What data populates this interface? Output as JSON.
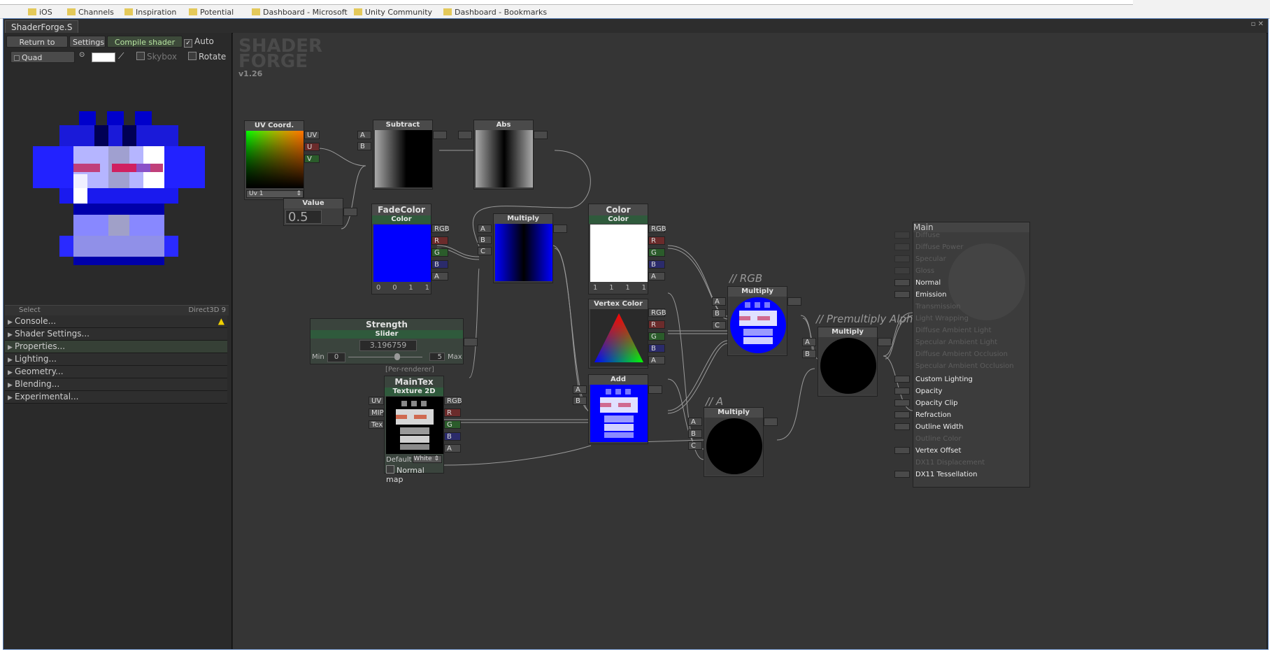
{
  "browser": {
    "bookmarks": [
      "iOS",
      "Channels",
      "Inspiration",
      "Potential",
      "Dashboard - Microsoft",
      "Unity Community",
      "Dashboard - Bookmarks"
    ]
  },
  "window": {
    "tab_title": "ShaderForge.S",
    "controls": "▫ ✕"
  },
  "toolbar": {
    "return_label": "Return to menu",
    "settings_label": "Settings",
    "compile_label": "Compile shader",
    "auto_label": "Auto",
    "auto_checked": true,
    "mesh_label": "Quad",
    "skybox_label": "Skybox",
    "rotate_label": "Rotate"
  },
  "panel": {
    "select_label": "Select",
    "renderer_label": "Direct3D 9",
    "menu_items": [
      "Console...",
      "Shader Settings...",
      "Properties...",
      "Lighting...",
      "Geometry...",
      "Blending...",
      "Experimental..."
    ]
  },
  "canvas": {
    "logo_line1": "SHADER",
    "logo_line2": "FORGE",
    "version": "v1.26",
    "comment_rgb": "// RGB",
    "comment_premultiply": "// Premultiply Alpha",
    "comment_a": "// A"
  },
  "nodes": {
    "uv": {
      "title": "UV Coord.",
      "ports": [
        "UV",
        "U",
        "V"
      ],
      "channel": "Uv 1"
    },
    "value": {
      "title": "Value",
      "value": "0.5"
    },
    "subtract": {
      "title": "Subtract",
      "in": [
        "A",
        "B"
      ]
    },
    "abs": {
      "title": "Abs"
    },
    "fadecolor": {
      "title": "FadeColor",
      "subtitle": "Color",
      "ports": [
        "RGB",
        "R",
        "G",
        "B",
        "A"
      ],
      "values": [
        "0",
        "0",
        "1",
        "1"
      ],
      "swatch": "#0000ff"
    },
    "multiply1": {
      "title": "Multiply",
      "in": [
        "A",
        "B",
        "C"
      ]
    },
    "color": {
      "title": "Color",
      "subtitle": "Color",
      "ports": [
        "RGB",
        "R",
        "G",
        "B",
        "A"
      ],
      "values": [
        "1",
        "1",
        "1",
        "1"
      ],
      "swatch": "#ffffff"
    },
    "vertexcolor": {
      "title": "Vertex Color",
      "ports": [
        "RGB",
        "R",
        "G",
        "B",
        "A"
      ]
    },
    "strength": {
      "title": "Strength",
      "subtitle": "Slider",
      "value": "3.196759",
      "min_label": "Min",
      "min": "0",
      "max": "5",
      "max_label": "Max",
      "footer": "[Per-renderer]"
    },
    "maintex": {
      "title": "MainTex",
      "subtitle": "Texture 2D",
      "in": [
        "UV",
        "MIP",
        "Tex"
      ],
      "ports": [
        "RGB",
        "R",
        "G",
        "B",
        "A"
      ],
      "default_label": "Default",
      "default_value": "White",
      "normal_label": "Normal map"
    },
    "add": {
      "title": "Add",
      "in": [
        "A",
        "B"
      ]
    },
    "multiply_rgb": {
      "title": "Multiply",
      "in": [
        "A",
        "B",
        "C"
      ]
    },
    "multiply_a": {
      "title": "Multiply",
      "in": [
        "A",
        "B",
        "C"
      ]
    },
    "multiply_pre": {
      "title": "Multiply",
      "in": [
        "A",
        "B"
      ]
    }
  },
  "main_node": {
    "title": "Main",
    "inputs": [
      {
        "label": "Diffuse",
        "active": false
      },
      {
        "label": "Diffuse Power",
        "active": false
      },
      {
        "label": "Specular",
        "active": false
      },
      {
        "label": "Gloss",
        "active": false
      },
      {
        "label": "Normal",
        "active": true
      },
      {
        "label": "Emission",
        "active": true
      },
      {
        "label": "Transmission",
        "active": false
      },
      {
        "label": "Light Wrapping",
        "active": false
      },
      {
        "label": "Diffuse Ambient Light",
        "active": false
      },
      {
        "label": "Specular Ambient Light",
        "active": false
      },
      {
        "label": "Diffuse Ambient Occlusion",
        "active": false
      },
      {
        "label": "Specular Ambient Occlusion",
        "active": false
      },
      {
        "label": "Custom Lighting",
        "active": true
      },
      {
        "label": "Opacity",
        "active": true
      },
      {
        "label": "Opacity Clip",
        "active": true
      },
      {
        "label": "Refraction",
        "active": true
      },
      {
        "label": "Outline Width",
        "active": true
      },
      {
        "label": "Outline Color",
        "active": false
      },
      {
        "label": "Vertex Offset",
        "active": true
      },
      {
        "label": "DX11 Displacement",
        "active": false
      },
      {
        "label": "DX11 Tessellation",
        "active": true
      }
    ]
  },
  "colors": {
    "accent_green": "#2f5a3c",
    "port_red": "#6b2b2b",
    "port_green": "#2b5c2b",
    "port_blue": "#2b2b6b",
    "window_border": "#5a7fb5"
  }
}
